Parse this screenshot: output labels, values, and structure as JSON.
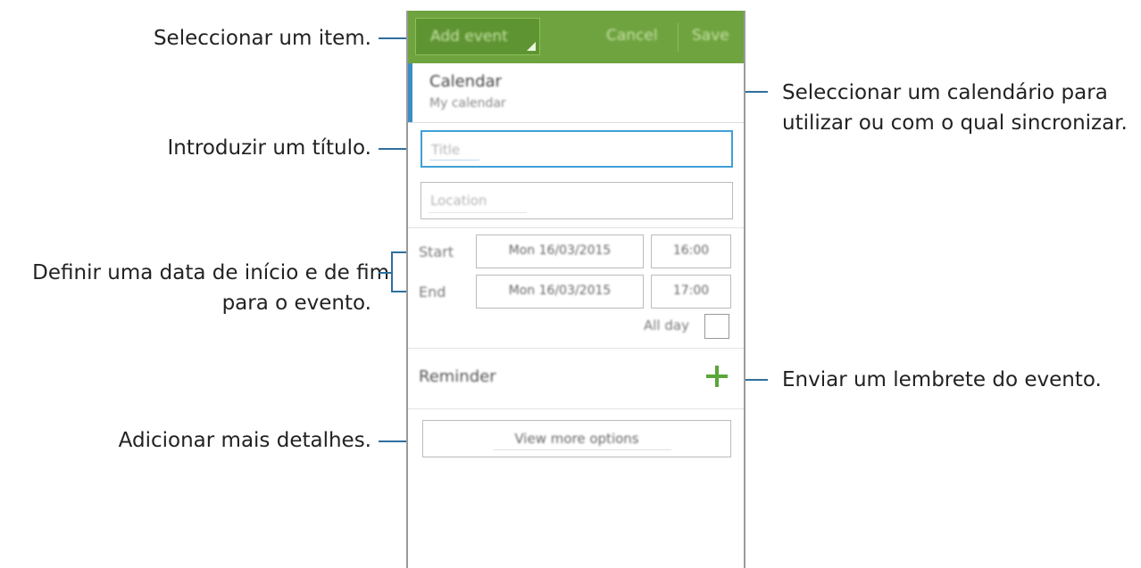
{
  "callouts": {
    "select_item": "Seleccionar um item.",
    "calendar_line1": "Seleccionar um calendário para",
    "calendar_line2": "utilizar ou com o qual sincronizar.",
    "title": "Introduzir um título.",
    "dates_line1": "Definir uma data de início e de fim",
    "dates_line2": "para o evento.",
    "reminder": "Enviar um lembrete do evento.",
    "more": "Adicionar mais detalhes."
  },
  "actionbar": {
    "dropdown_label": "Add event",
    "cancel_label": "Cancel",
    "save_label": "Save"
  },
  "calendar": {
    "title": "Calendar",
    "value": "My calendar"
  },
  "form": {
    "title_placeholder": "Title",
    "location_placeholder": "Location",
    "start_label": "Start",
    "start_date": "Mon 16/03/2015",
    "start_time": "16:00",
    "end_label": "End",
    "end_date": "Mon 16/03/2015",
    "end_time": "17:00",
    "allday_label": "All day",
    "allday_checked": false,
    "reminder_label": "Reminder",
    "more_options_label": "View more options"
  },
  "colors": {
    "actionbar": "#6fa33f",
    "accent_blue": "#3f9fd8",
    "plus_green": "#5aa63a",
    "callout_line": "#2f6f9f"
  }
}
